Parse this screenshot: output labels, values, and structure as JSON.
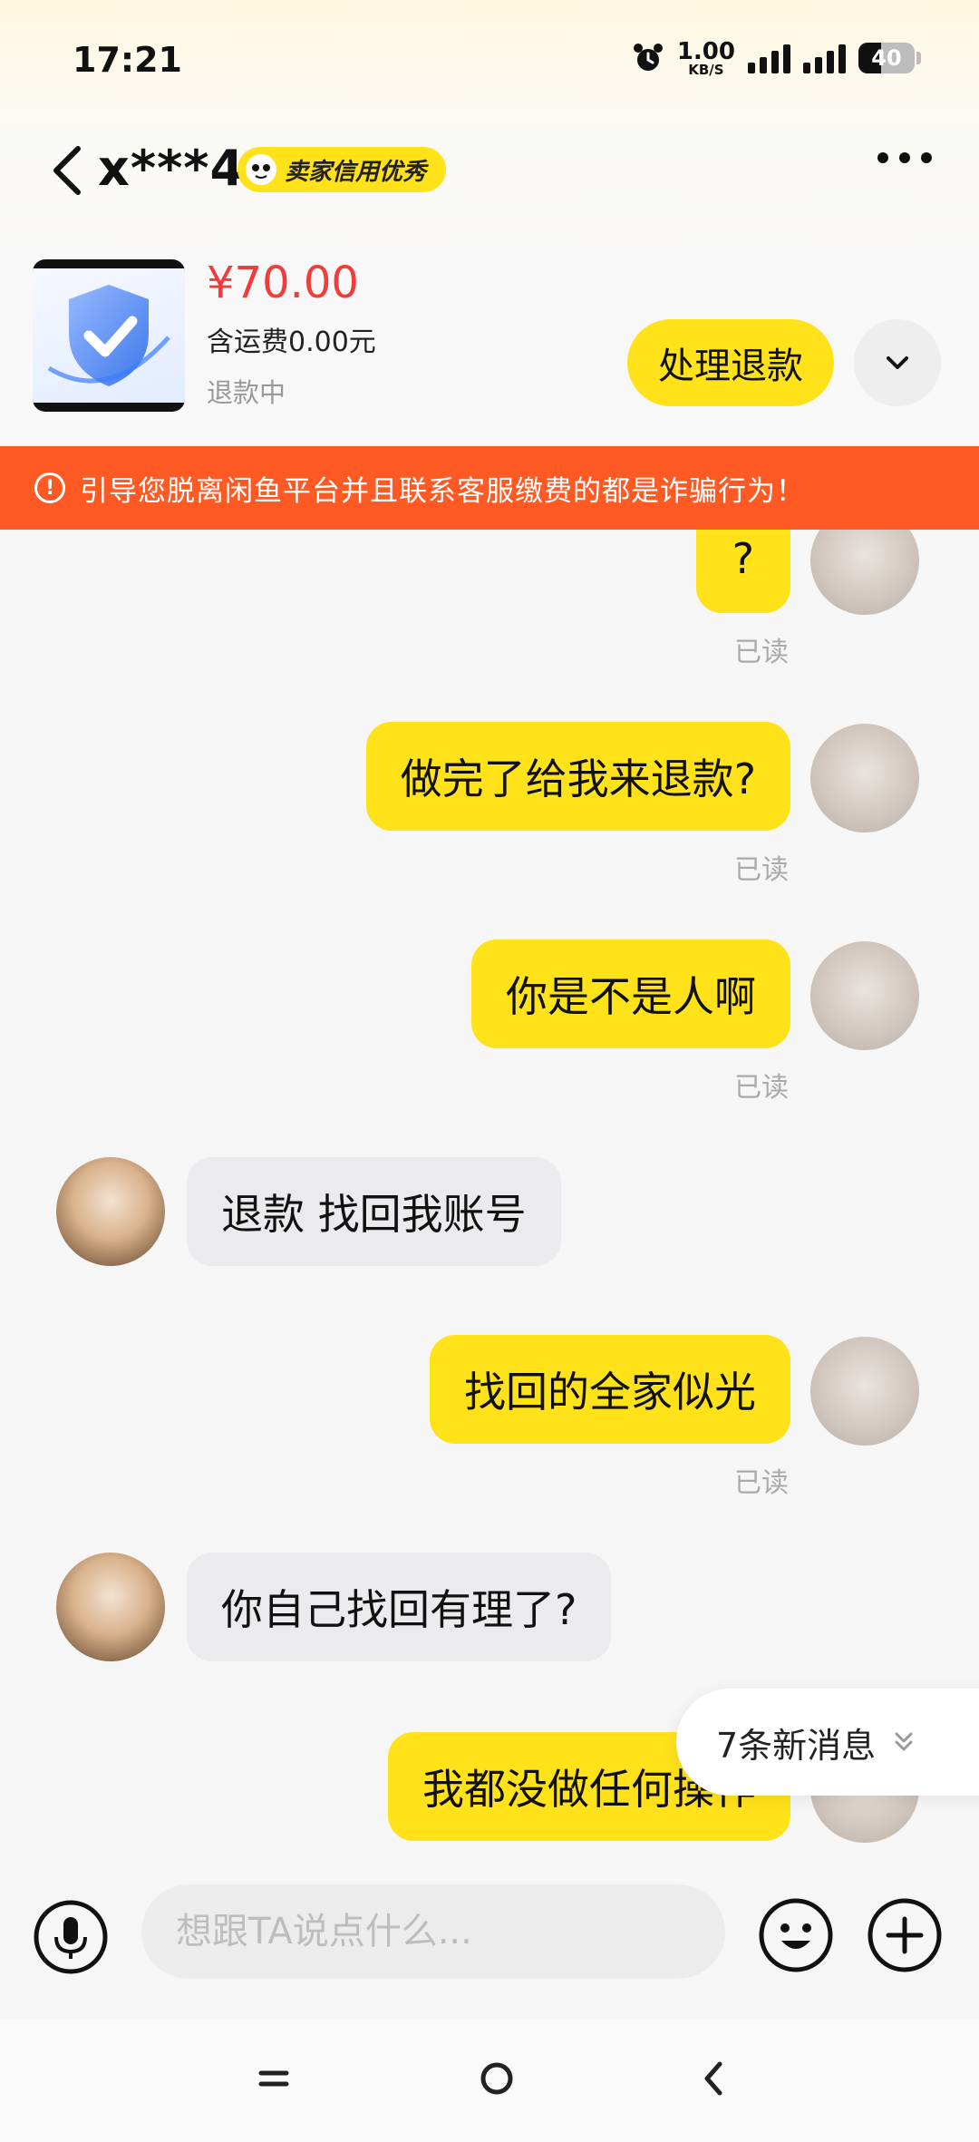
{
  "status_bar": {
    "time": "17:21",
    "net_speed_value": "1.00",
    "net_speed_unit": "KB/S",
    "battery": "40",
    "battery_level": 0.4
  },
  "header": {
    "title": "x***4",
    "credit_badge": "卖家信用优秀"
  },
  "product": {
    "price": "¥70.00",
    "shipping": "含运费0.00元",
    "status": "退款中",
    "action_label": "处理退款"
  },
  "warning": {
    "text": "引导您脱离闲鱼平台并且联系客服缴费的都是诈骗行为！"
  },
  "messages": [
    {
      "from": "me",
      "text": "?",
      "read": "已读"
    },
    {
      "from": "me",
      "text": "做完了给我来退款?",
      "read": "已读"
    },
    {
      "from": "me",
      "text": "你是不是人啊",
      "read": "已读"
    },
    {
      "from": "other",
      "text": "退款 找回我账号"
    },
    {
      "from": "me",
      "text": "找回的全家似光",
      "read": "已读"
    },
    {
      "from": "other",
      "text": "你自己找回有理了?"
    },
    {
      "from": "me",
      "text": "我都没做任何操作"
    }
  ],
  "new_messages": "7条新消息",
  "input": {
    "placeholder": "想跟TA说点什么..."
  },
  "colors": {
    "accent_yellow": "#ffe21a",
    "price_red": "#f23b3b",
    "warning_orange": "#ff5a24"
  },
  "icons": [
    "alarm-icon",
    "signal-icon",
    "battery-icon",
    "back-arrow-icon",
    "credit-face-icon",
    "more-icon",
    "chevron-down-icon",
    "warning-icon",
    "double-chevron-down-icon",
    "microphone-icon",
    "emoji-icon",
    "plus-icon",
    "nav-menu-icon",
    "nav-home-icon",
    "nav-back-icon"
  ]
}
